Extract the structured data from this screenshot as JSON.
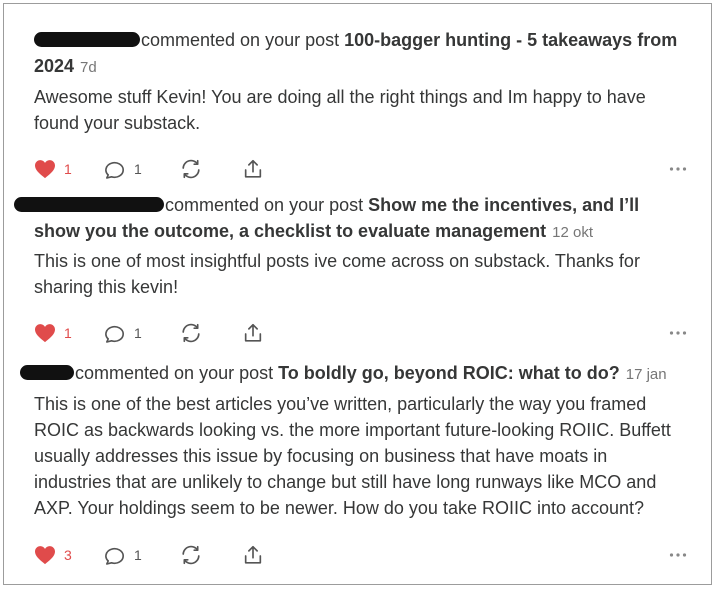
{
  "comments": [
    {
      "action_text": "commented on your post ",
      "post_title": "100-bagger hunting - 5 takeaways from 2024",
      "time": "7d",
      "body": "Awesome stuff Kevin! You are doing all the right things and Im happy to have found your substack.",
      "likes": "1",
      "replies": "1"
    },
    {
      "action_text": "commented on your post ",
      "post_title": "Show me the incentives, and I’ll show you the outcome, a checklist to evaluate management",
      "time": "12 okt",
      "body": "This is one of most insightful posts ive come across on substack. Thanks for sharing this kevin!",
      "likes": "1",
      "replies": "1"
    },
    {
      "action_text": "commented on your post ",
      "post_title": "To boldly go, beyond ROIC: what to do?",
      "time": "17 jan",
      "body": "This is one of the best articles you’ve written, particularly the way you framed ROIC as backwards looking vs. the more important future-looking ROIIC. Buffett usually addresses this issue by focusing on business that have moats in industries that are unlikely to change but still have long runways like MCO and AXP. Your holdings seem to be newer. How do you take ROIIC into account?",
      "likes": "3",
      "replies": "1"
    }
  ],
  "colors": {
    "heart": "#e04b4b",
    "text": "#363737",
    "muted": "#767676",
    "icon": "#555555"
  },
  "icons": [
    "heart-icon",
    "comment-icon",
    "restack-icon",
    "share-icon",
    "more-icon"
  ]
}
